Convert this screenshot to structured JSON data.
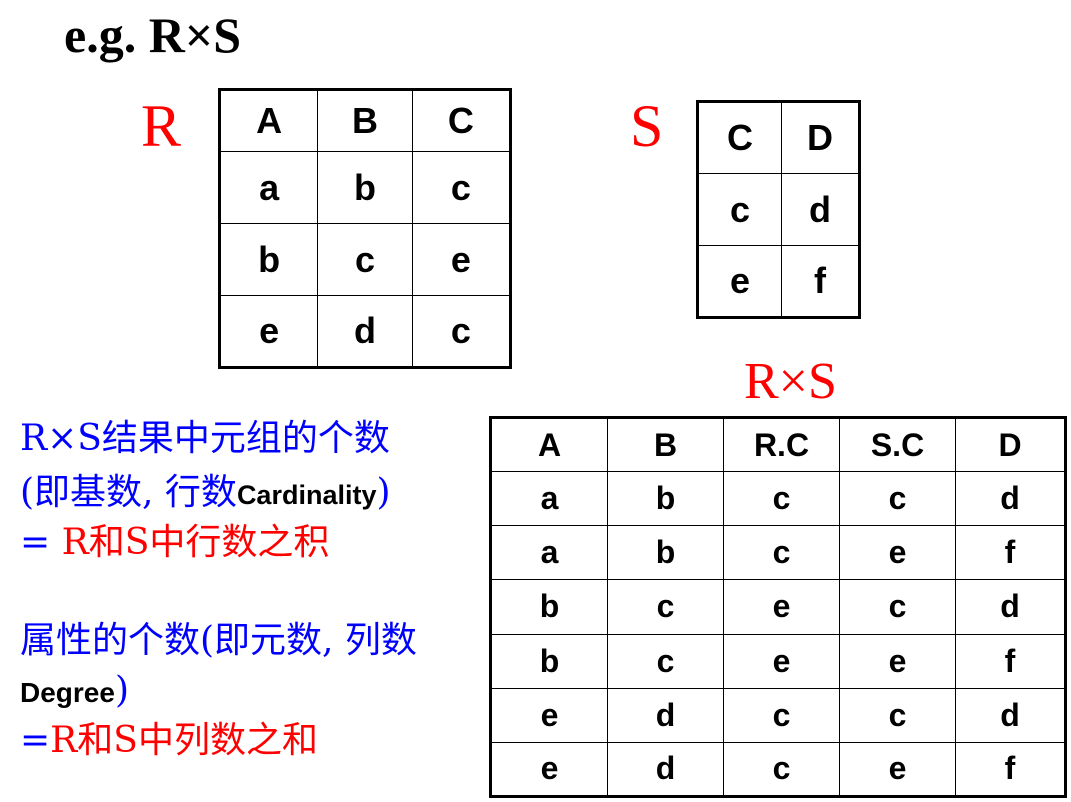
{
  "title": "e.g.  R×S",
  "relation_r": {
    "label": "R",
    "headers": [
      "A",
      "B",
      "C"
    ],
    "rows": [
      [
        "a",
        "b",
        "c"
      ],
      [
        "b",
        "c",
        "e"
      ],
      [
        "e",
        "d",
        "c"
      ]
    ]
  },
  "relation_s": {
    "label": "S",
    "headers": [
      "C",
      "D"
    ],
    "rows": [
      [
        "c",
        "d"
      ],
      [
        "e",
        "f"
      ]
    ]
  },
  "product": {
    "label": "R×S",
    "headers": [
      "A",
      "B",
      "R.C",
      "S.C",
      "D"
    ],
    "rows": [
      [
        "a",
        "b",
        "c",
        "c",
        "d"
      ],
      [
        "a",
        "b",
        "c",
        "e",
        "f"
      ],
      [
        "b",
        "c",
        "e",
        "c",
        "d"
      ],
      [
        "b",
        "c",
        "e",
        "e",
        "f"
      ],
      [
        "e",
        "d",
        "c",
        "c",
        "d"
      ],
      [
        "e",
        "d",
        "c",
        "e",
        "f"
      ]
    ]
  },
  "notes": {
    "cardinality_line1": "R×S结果中元组的个数",
    "cardinality_line2_prefix": "(即基数, 行数",
    "cardinality_term": "Cardinality",
    "cardinality_line2_suffix": ")",
    "cardinality_line3_eq": "= ",
    "cardinality_line3_text": "R和S中行数之积",
    "degree_line1": "属性的个数(即元数, 列数",
    "degree_term": "Degree",
    "degree_line2_suffix": ")",
    "degree_line3_eq": "=",
    "degree_line3_text": "R和S中列数之和"
  },
  "colors": {
    "note_blue": "#0000ff",
    "accent_red": "#ff0000",
    "text_black": "#000000"
  }
}
